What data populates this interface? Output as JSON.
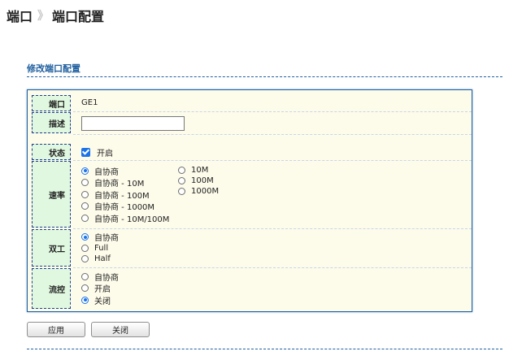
{
  "breadcrumb": {
    "root": "端口",
    "separator": "》",
    "current": "端口配置"
  },
  "section": {
    "title": "修改端口配置"
  },
  "form": {
    "port": {
      "label": "端口",
      "value": "GE1"
    },
    "description": {
      "label": "描述",
      "value": ""
    },
    "status": {
      "label": "状态",
      "option": "开启",
      "checked": true
    },
    "speed": {
      "label": "速率",
      "col1": [
        {
          "label": "自协商",
          "checked": true
        },
        {
          "label": "自协商 - 10M",
          "checked": false
        },
        {
          "label": "自协商 - 100M",
          "checked": false
        },
        {
          "label": "自协商 - 1000M",
          "checked": false
        },
        {
          "label": "自协商 - 10M/100M",
          "checked": false
        }
      ],
      "col2": [
        {
          "label": "10M",
          "checked": false
        },
        {
          "label": "100M",
          "checked": false
        },
        {
          "label": "1000M",
          "checked": false
        }
      ]
    },
    "duplex": {
      "label": "双工",
      "options": [
        {
          "label": "自协商",
          "checked": true
        },
        {
          "label": "Full",
          "checked": false
        },
        {
          "label": "Half",
          "checked": false
        }
      ]
    },
    "flow": {
      "label": "流控",
      "options": [
        {
          "label": "自协商",
          "checked": false
        },
        {
          "label": "开启",
          "checked": false
        },
        {
          "label": "关闭",
          "checked": true
        }
      ]
    }
  },
  "buttons": {
    "apply": "应用",
    "close": "关闭"
  },
  "colors": {
    "accent": "#1f5f9f",
    "label_bg": "#e0f8e0",
    "panel_bg": "#fdfbea",
    "radio_selected": "#1a73e8"
  }
}
